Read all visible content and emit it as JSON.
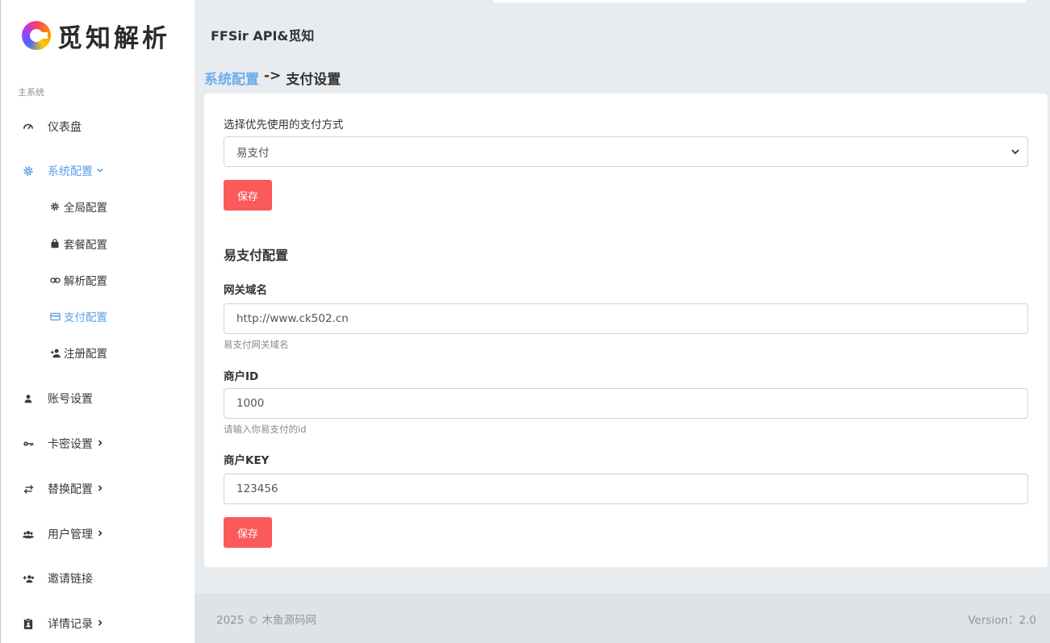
{
  "brand": {
    "logo_text": "觅知解析"
  },
  "header": {
    "app_title": "FFSir API&觅知"
  },
  "sidebar": {
    "section_label": "主系统",
    "items": [
      {
        "label": "仪表盘",
        "icon": "gauge-icon"
      },
      {
        "label": "系统配置",
        "icon": "gear-icon",
        "active": true,
        "expanded": true
      },
      {
        "label": "账号设置",
        "icon": "user-icon"
      },
      {
        "label": "卡密设置",
        "icon": "key-icon"
      },
      {
        "label": "替换配置",
        "icon": "swap-icon"
      },
      {
        "label": "用户管理",
        "icon": "users-icon"
      },
      {
        "label": "邀请链接",
        "icon": "user-plus-icon"
      },
      {
        "label": "详情记录",
        "icon": "clipboard-icon"
      }
    ],
    "sub_items": [
      {
        "label": "全局配置",
        "icon": "cog-icon"
      },
      {
        "label": "套餐配置",
        "icon": "bag-icon"
      },
      {
        "label": "解析配置",
        "icon": "link-icon"
      },
      {
        "label": "支付配置",
        "icon": "card-icon",
        "active": true
      },
      {
        "label": "注册配置",
        "icon": "user-add-icon"
      }
    ]
  },
  "breadcrumb": {
    "parent": "系统配置",
    "separator": "->",
    "current": "支付设置"
  },
  "form": {
    "payment_method_label": "选择优先使用的支付方式",
    "payment_method_value": "易支付",
    "save_label": "保存",
    "epay_section_title": "易支付配置",
    "gateway_label": "网关域名",
    "gateway_value": "http://www.ck502.cn",
    "gateway_hint": "易支付网关域名",
    "merchant_id_label": "商户ID",
    "merchant_id_value": "1000",
    "merchant_id_hint": "请输入你易支付的id",
    "merchant_key_label": "商户KEY",
    "merchant_key_value": "123456",
    "save_label_2": "保存"
  },
  "footer": {
    "copyright": "2025 © 木鱼源码网",
    "version": "Version：2.0"
  },
  "colors": {
    "accent": "#5aa2e8",
    "button": "#fa5a5a"
  }
}
